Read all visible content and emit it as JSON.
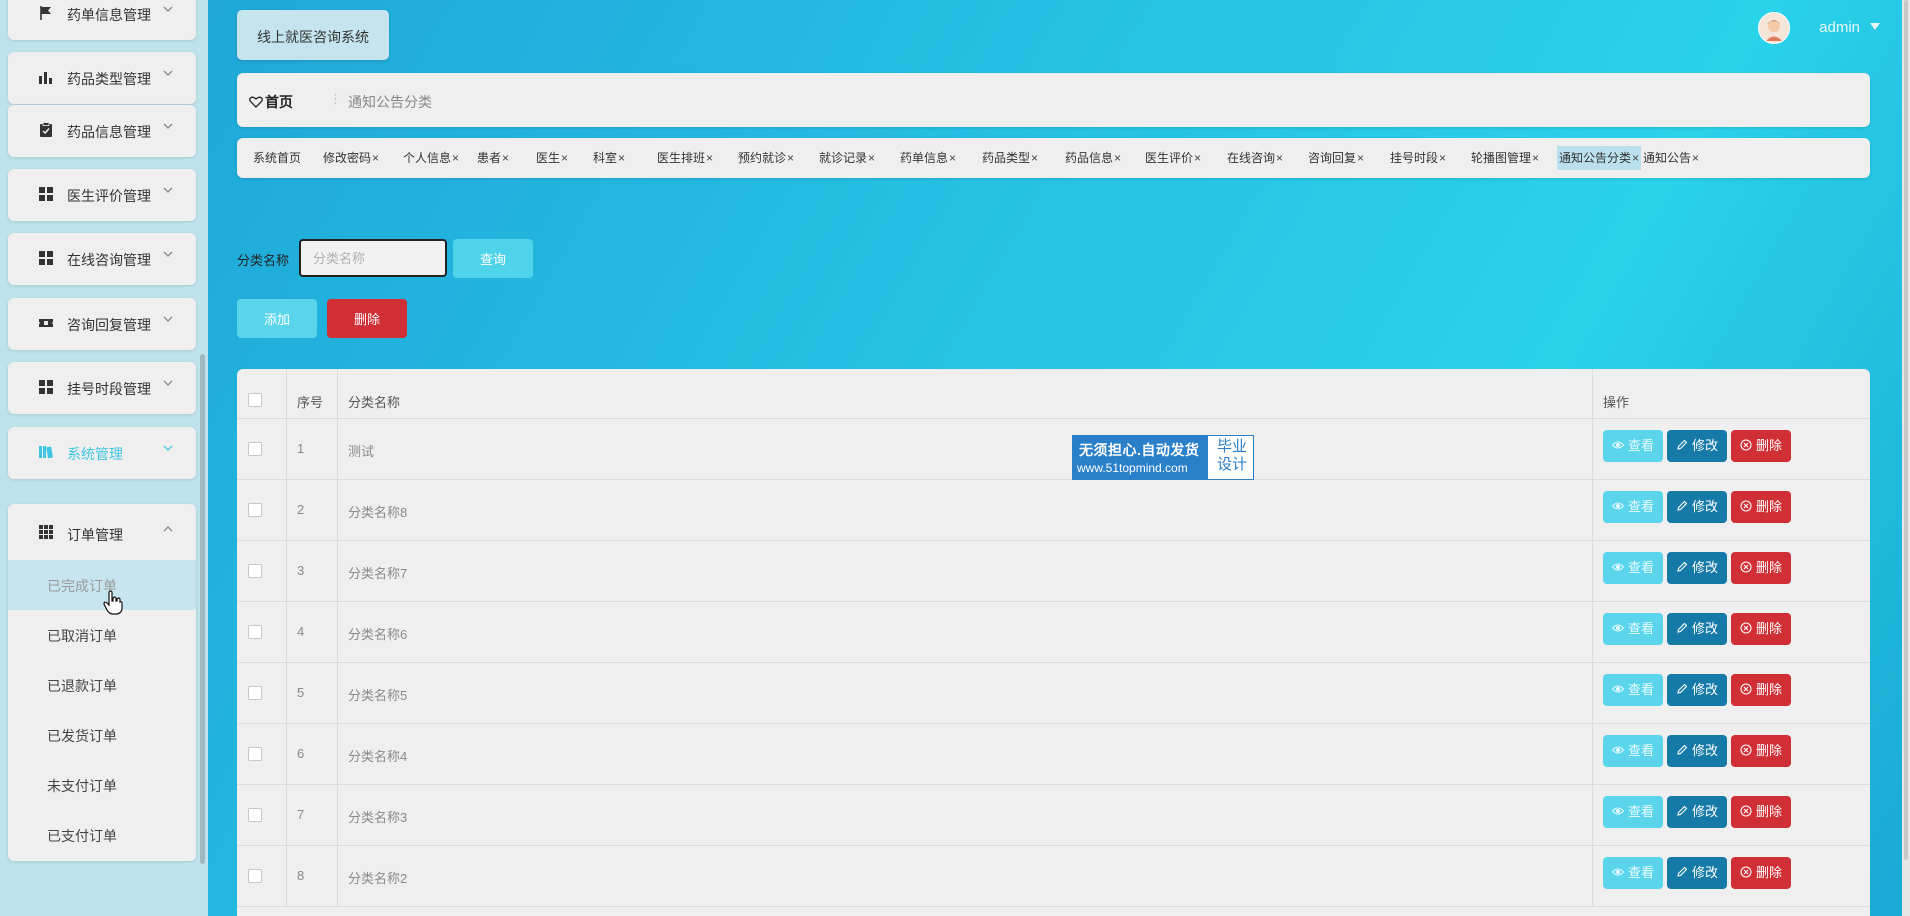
{
  "sidebar": {
    "menus": [
      {
        "label": "药单信息管理",
        "icon": "flag-icon"
      },
      {
        "label": "药品类型管理",
        "icon": "bar-chart-icon"
      },
      {
        "label": "药品信息管理",
        "icon": "clipboard-check-icon"
      },
      {
        "label": "医生评价管理",
        "icon": "grid-icon"
      },
      {
        "label": "在线咨询管理",
        "icon": "grid-icon"
      },
      {
        "label": "咨询回复管理",
        "icon": "ticket-icon"
      },
      {
        "label": "挂号时段管理",
        "icon": "grid-icon"
      },
      {
        "label": "系统管理",
        "icon": "library-icon"
      }
    ],
    "order_menu": {
      "label": "订单管理",
      "icon": "apps-grid-icon",
      "items": [
        "已完成订单",
        "已取消订单",
        "已退款订单",
        "已发货订单",
        "未支付订单",
        "已支付订单"
      ]
    }
  },
  "header": {
    "system_title": "线上就医咨询系统",
    "username": "admin"
  },
  "breadcrumb": {
    "home": "首页",
    "separator": "⋮",
    "current": "通知公告分类"
  },
  "tabs": [
    {
      "label": "系统首页",
      "closable": false
    },
    {
      "label": "修改密码",
      "closable": true
    },
    {
      "label": "个人信息",
      "closable": true
    },
    {
      "label": "患者",
      "closable": true
    },
    {
      "label": "医生",
      "closable": true
    },
    {
      "label": "科室",
      "closable": true
    },
    {
      "label": "医生排班",
      "closable": true
    },
    {
      "label": "预约就诊",
      "closable": true
    },
    {
      "label": "就诊记录",
      "closable": true
    },
    {
      "label": "药单信息",
      "closable": true
    },
    {
      "label": "药品类型",
      "closable": true
    },
    {
      "label": "药品信息",
      "closable": true
    },
    {
      "label": "医生评价",
      "closable": true
    },
    {
      "label": "在线咨询",
      "closable": true
    },
    {
      "label": "咨询回复",
      "closable": true
    },
    {
      "label": "挂号时段",
      "closable": true
    },
    {
      "label": "轮播图管理",
      "closable": true
    },
    {
      "label": "通知公告分类",
      "closable": true,
      "active": true
    },
    {
      "label": "通知公告",
      "closable": true
    }
  ],
  "search": {
    "label": "分类名称",
    "placeholder": "分类名称",
    "value": "",
    "query_button": "查询"
  },
  "actions": {
    "add_button": "添加",
    "delete_button": "删除"
  },
  "table": {
    "headers": {
      "index": "序号",
      "name": "分类名称",
      "ops": "操作"
    },
    "rows": [
      {
        "index": "1",
        "name": "测试"
      },
      {
        "index": "2",
        "name": "分类名称8"
      },
      {
        "index": "3",
        "name": "分类名称7"
      },
      {
        "index": "4",
        "name": "分类名称6"
      },
      {
        "index": "5",
        "name": "分类名称5"
      },
      {
        "index": "6",
        "name": "分类名称4"
      },
      {
        "index": "7",
        "name": "分类名称3"
      },
      {
        "index": "8",
        "name": "分类名称2"
      }
    ],
    "row_actions": {
      "view": "查看",
      "edit": "修改",
      "delete": "删除"
    }
  },
  "watermark": {
    "line1": "无须担心.自动发货",
    "line2": "www.51topmind.com",
    "side": "毕业设计"
  },
  "colors": {
    "accent": "#3ec6e3",
    "view_button": "#5ad5ec",
    "edit_button": "#167aa8",
    "delete_button": "#d12f36"
  }
}
